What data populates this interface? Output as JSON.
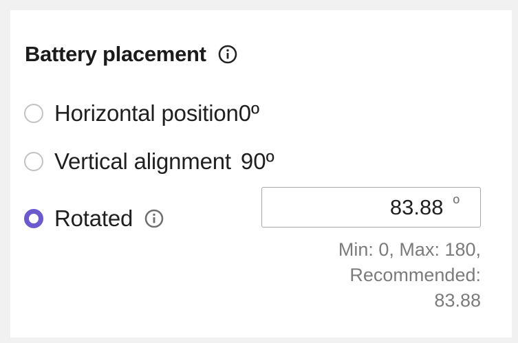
{
  "section": {
    "title": "Battery placement"
  },
  "options": [
    {
      "label": "Horizontal position",
      "degrees": "0º",
      "selected": false
    },
    {
      "label": "Vertical alignment",
      "degrees": "90º",
      "selected": false
    },
    {
      "label": "Rotated",
      "selected": true
    }
  ],
  "angle_input": {
    "value": "83.88",
    "unit": "º"
  },
  "hint": {
    "line1": "Min: 0, Max: 180,",
    "line2": "Recommended:",
    "line3": "83.88"
  },
  "icons": {
    "title_info": "info-icon",
    "rotated_info": "info-icon"
  },
  "colors": {
    "accent": "#6a5acd",
    "radio_border": "#c2c2c2",
    "hint_text": "#7b7b7b",
    "info_icon": "#222222",
    "info_icon_muted": "#6f6f6f"
  }
}
